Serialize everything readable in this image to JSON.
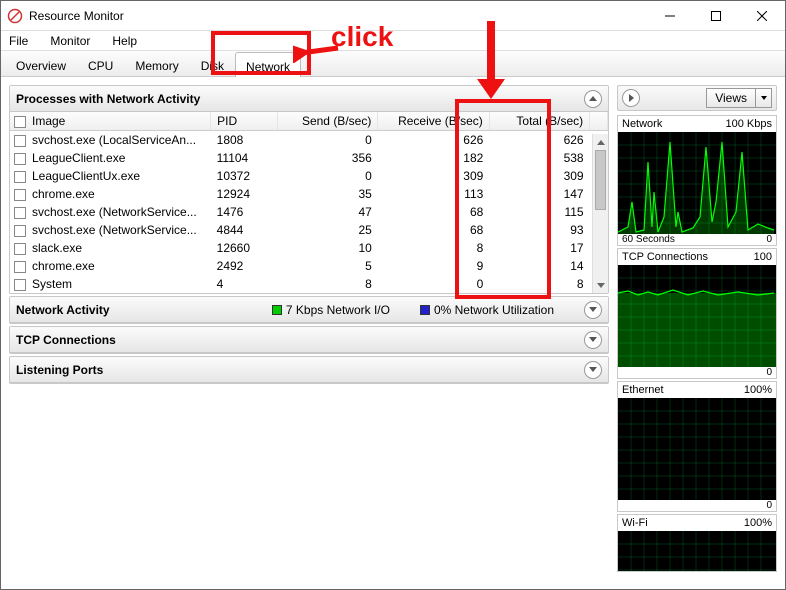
{
  "title": "Resource Monitor",
  "menu": [
    "File",
    "Monitor",
    "Help"
  ],
  "tabs": [
    "Overview",
    "CPU",
    "Memory",
    "Disk",
    "Network"
  ],
  "activeTab": "Network",
  "sections": {
    "processes": {
      "title": "Processes with Network Activity"
    },
    "activity": {
      "title": "Network Activity",
      "io": "7 Kbps Network I/O",
      "util": "0% Network Utilization"
    },
    "tcp": {
      "title": "TCP Connections"
    },
    "listening": {
      "title": "Listening Ports"
    }
  },
  "columns": [
    "Image",
    "PID",
    "Send (B/sec)",
    "Receive (B/sec)",
    "Total (B/sec)"
  ],
  "rows": [
    {
      "image": "svchost.exe (LocalServiceAn...",
      "pid": 1808,
      "send": 0,
      "recv": 626,
      "total": 626
    },
    {
      "image": "LeagueClient.exe",
      "pid": 11104,
      "send": 356,
      "recv": 182,
      "total": 538
    },
    {
      "image": "LeagueClientUx.exe",
      "pid": 10372,
      "send": 0,
      "recv": 309,
      "total": 309
    },
    {
      "image": "chrome.exe",
      "pid": 12924,
      "send": 35,
      "recv": 113,
      "total": 147
    },
    {
      "image": "svchost.exe (NetworkService...",
      "pid": 1476,
      "send": 47,
      "recv": 68,
      "total": 115
    },
    {
      "image": "svchost.exe (NetworkService...",
      "pid": 4844,
      "send": 25,
      "recv": 68,
      "total": 93
    },
    {
      "image": "slack.exe",
      "pid": 12660,
      "send": 10,
      "recv": 8,
      "total": 17
    },
    {
      "image": "chrome.exe",
      "pid": 2492,
      "send": 5,
      "recv": 9,
      "total": 14
    },
    {
      "image": "System",
      "pid": 4,
      "send": 8,
      "recv": 0,
      "total": 8
    }
  ],
  "views_label": "Views",
  "graphs": [
    {
      "title": "Network",
      "right": "100 Kbps",
      "footL": "60 Seconds",
      "footR": "0",
      "style": "spikes"
    },
    {
      "title": "TCP Connections",
      "right": "100",
      "footR": "0",
      "style": "flat"
    },
    {
      "title": "Ethernet",
      "right": "100%",
      "footR": "0",
      "style": "empty"
    },
    {
      "title": "Wi-Fi",
      "right": "100%",
      "style": "partial"
    }
  ],
  "annotations": {
    "click_label": "click"
  }
}
